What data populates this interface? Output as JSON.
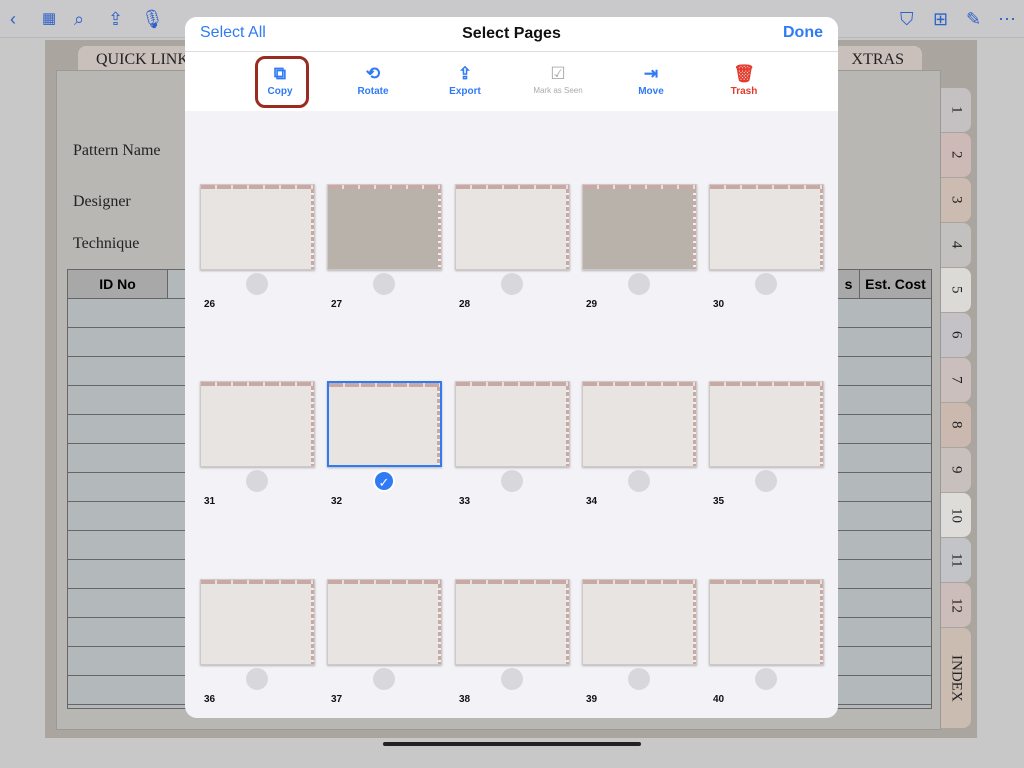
{
  "app": {
    "icons": [
      "back-icon",
      "grid-icon",
      "search-icon",
      "share-icon",
      "microphone-icon",
      "bookmark-icon",
      "add-page-icon",
      "pen-icon",
      "more-icon"
    ]
  },
  "background": {
    "tabs": [
      "QUICK LINKS",
      "XTRAS"
    ],
    "fields": [
      "Pattern Name",
      "Designer",
      "Technique"
    ],
    "table_headers": [
      "ID No",
      "s",
      "Est. Cost"
    ],
    "side_tabs": [
      "1",
      "2",
      "3",
      "4",
      "5",
      "6",
      "7",
      "8",
      "9",
      "10",
      "11",
      "12",
      "INDEX"
    ]
  },
  "modal": {
    "select_all": "Select All",
    "title": "Select Pages",
    "done": "Done",
    "actions": [
      {
        "label": "Copy",
        "icon": "copy-icon"
      },
      {
        "label": "Rotate",
        "icon": "rotate-icon"
      },
      {
        "label": "Export",
        "icon": "export-icon"
      },
      {
        "label": "Mark as Seen",
        "icon": "checkbox-icon",
        "disabled": true
      },
      {
        "label": "Move",
        "icon": "move-icon"
      },
      {
        "label": "Trash",
        "icon": "trash-icon"
      }
    ],
    "pages": [
      "26",
      "27",
      "28",
      "29",
      "30",
      "31",
      "32",
      "33",
      "34",
      "35",
      "36",
      "37",
      "38",
      "39",
      "40"
    ],
    "selected_page": "32",
    "accent": "#2f7bf5"
  }
}
